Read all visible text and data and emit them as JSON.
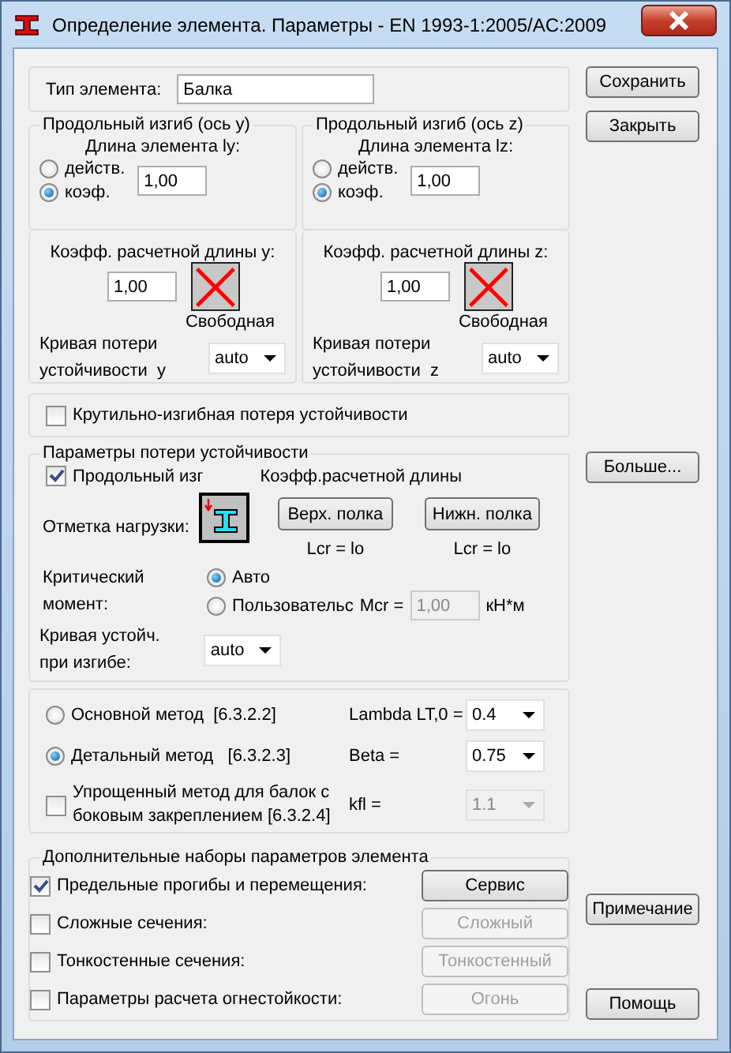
{
  "window": {
    "title": "Определение элемента. Параметры - EN 1993-1:2005/AC:2009"
  },
  "element_type": {
    "label": "Тип элемента:",
    "value": "Балка"
  },
  "buckling": [
    {
      "title": "Продольный изгиб (ось y)",
      "length_label": "Длина элемента ly:",
      "options": [
        {
          "label": "действ.",
          "selected": false
        },
        {
          "label": "коэф.",
          "selected": true
        }
      ],
      "length_value": "1,00",
      "coef_label": "Коэфф. расчетной длины y:",
      "coef_value": "1,00",
      "support_label": "Свободная",
      "curve_label": "Кривая потери\nустойчивости  y",
      "curve_value": "auto"
    },
    {
      "title": "Продольный изгиб (ось z)",
      "length_label": "Длина элемента lz:",
      "options": [
        {
          "label": "действ.",
          "selected": false
        },
        {
          "label": "коэф.",
          "selected": true
        }
      ],
      "length_value": "1,00",
      "coef_label": "Коэфф. расчетной длины z:",
      "coef_value": "1,00",
      "support_label": "Свободная",
      "curve_label": "Кривая потери\nустойчивости  z",
      "curve_value": "auto"
    }
  ],
  "torsional": {
    "label": "Крутильно-изгибная потеря устойчивости",
    "checked": false
  },
  "stability": {
    "title": "Параметры потери устойчивости",
    "buckling_check": {
      "label": "Продольный изг",
      "checked": true
    },
    "coef_header": "Коэфф.расчетной длины",
    "load_label": "Отметка нагрузки:",
    "flanges": [
      {
        "label": "Верх. полка",
        "lcr": "Lcr =  lo"
      },
      {
        "label": "Нижн. полка",
        "lcr": "Lcr =  lo"
      }
    ],
    "critical_label": "Критический\nмомент:",
    "moment_options": [
      {
        "label": "Авто",
        "selected": true
      },
      {
        "label": "Пользовательс",
        "selected": false
      }
    ],
    "mcr_label": "Mcr =",
    "mcr_value": "1,00",
    "mcr_disabled": true,
    "mcr_unit": "кН*м",
    "curve_label": "Кривая устойч.\nпри изгибе:",
    "curve_value": "auto"
  },
  "method": [
    {
      "kind": "radio",
      "label": "Основной метод  [6.3.2.2]",
      "selected": false,
      "param_label": "Lambda LT,0 =",
      "param_value": "0.4",
      "disabled": false
    },
    {
      "kind": "radio",
      "label": "Детальный метод   [6.3.2.3]",
      "selected": true,
      "param_label": "Beta =",
      "param_value": "0.75",
      "disabled": false
    },
    {
      "kind": "checkbox",
      "label": "Упрощенный метод для балок с\nбоковым закреплением [6.3.2.4]",
      "checked": false,
      "param_label": "kfl =",
      "param_value": "1.1",
      "disabled": true
    }
  ],
  "additional": {
    "title": "Дополнительные наборы параметров элемента",
    "rows": [
      {
        "label": "Предельные прогибы и перемещения:",
        "checked": true,
        "button": "Сервис",
        "disabled": false
      },
      {
        "label": "Сложные сечения:",
        "checked": false,
        "button": "Сложный",
        "disabled": true
      },
      {
        "label": "Тонкостенные сечения:",
        "checked": false,
        "button": "Тонкостенный",
        "disabled": true
      },
      {
        "label": "Параметры расчета огнестойкости:",
        "checked": false,
        "button": "Огонь",
        "disabled": true
      }
    ]
  },
  "side_buttons": [
    {
      "label": "Сохранить"
    },
    {
      "label": "Закрыть"
    },
    {
      "label": "Больше..."
    },
    {
      "label": "Примечание"
    },
    {
      "label": "Помощь"
    }
  ]
}
